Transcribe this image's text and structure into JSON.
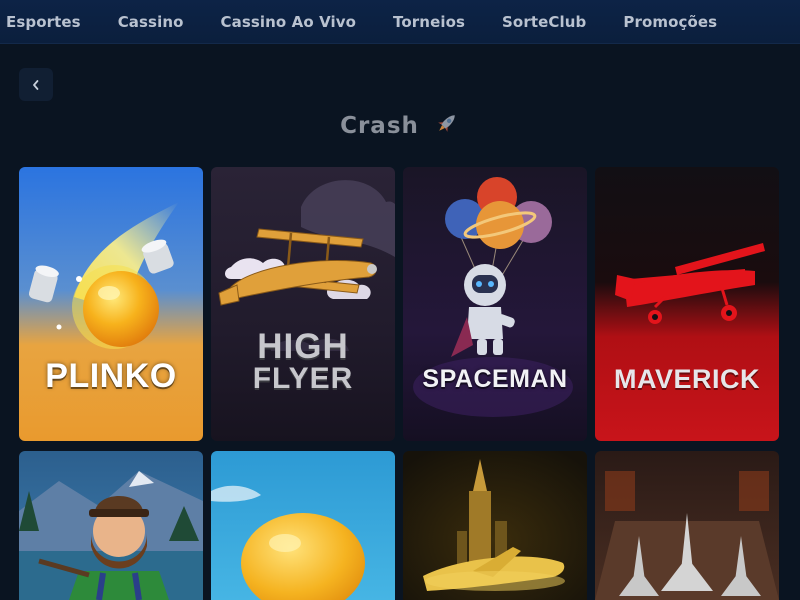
{
  "nav": {
    "items": [
      "Esportes",
      "Cassino",
      "Cassino Ao Vivo",
      "Torneios",
      "SorteClub",
      "Promoções"
    ]
  },
  "page": {
    "back_icon": "chevron-left-icon",
    "title": "Crash",
    "title_icon": "rocket-icon"
  },
  "games": [
    {
      "label": "PLINKO"
    },
    {
      "label_line1": "HIGH",
      "label_line2": "FLYER"
    },
    {
      "label": "SPACEMAN"
    },
    {
      "label": "MAVERICK"
    }
  ],
  "colors": {
    "page_bg": "#0a1421",
    "nav_bg": "#0d2346",
    "maverick_red": "#d6141a",
    "plinko_blue": "#2f7fe0",
    "plinko_orange": "#f2a23a"
  }
}
